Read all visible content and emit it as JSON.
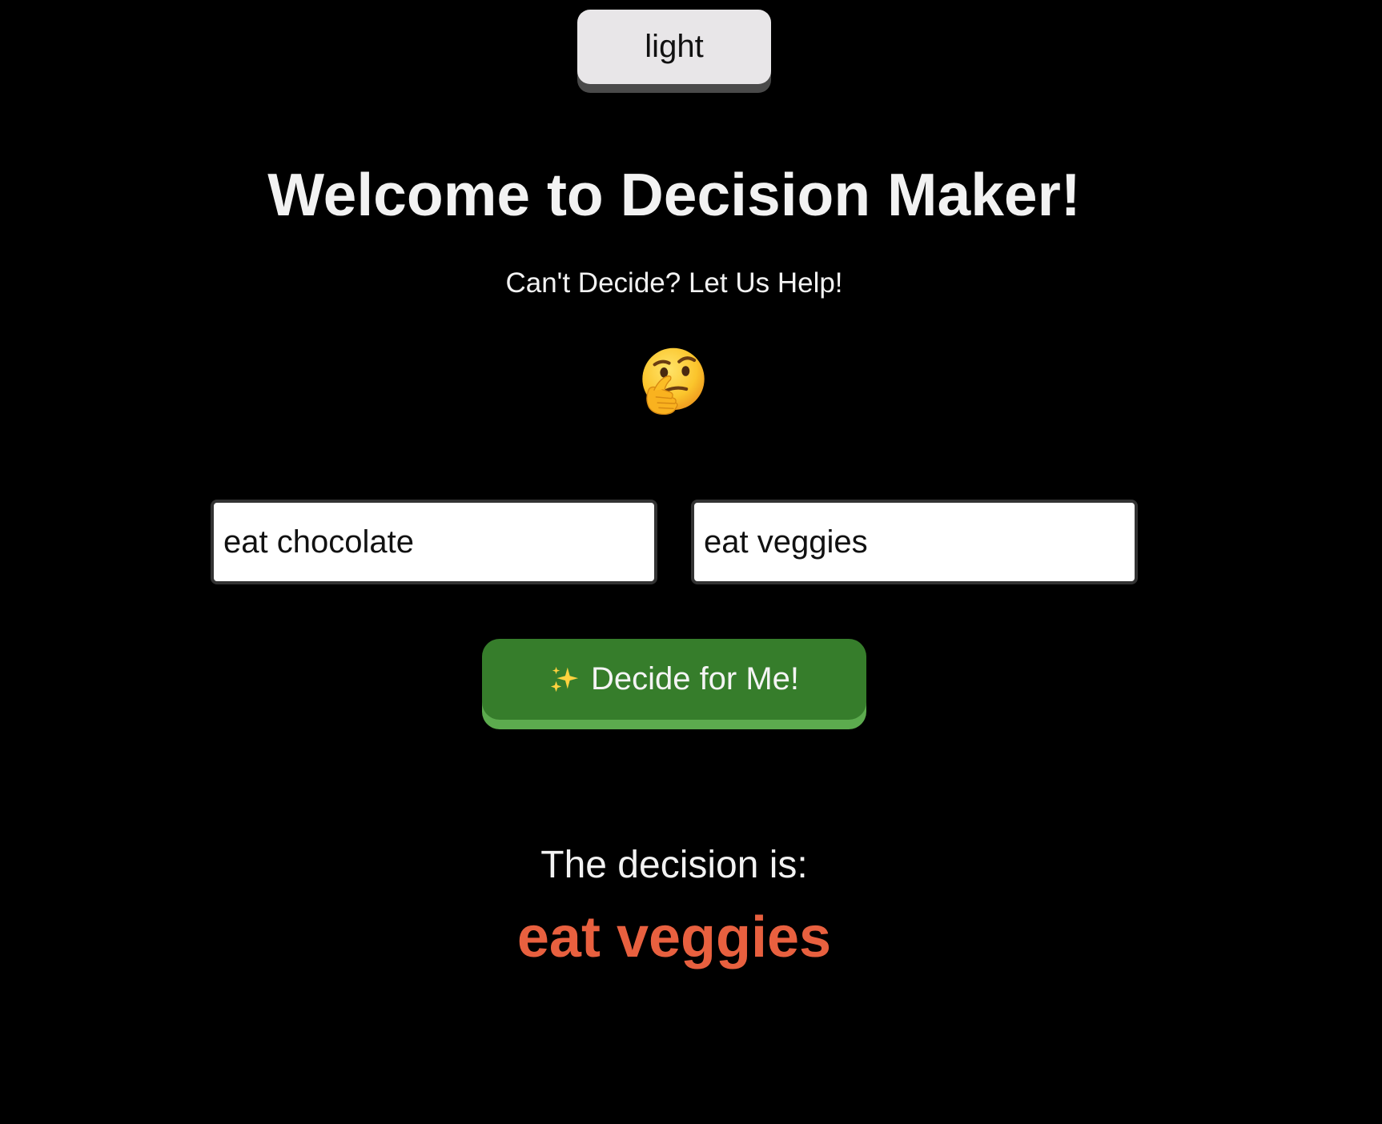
{
  "theme_toggle": {
    "label": "light"
  },
  "header": {
    "title": "Welcome to Decision Maker!",
    "subtitle": "Can't Decide? Let Us Help!",
    "emoji_icon": "thinking-face-icon"
  },
  "options": {
    "option_1_value": "eat chocolate",
    "option_2_value": "eat veggies"
  },
  "decide_button": {
    "icon": "sparkles-icon",
    "label": "Decide for Me!"
  },
  "result": {
    "label": "The decision is:",
    "value": "eat veggies"
  },
  "colors": {
    "background": "#000000",
    "text": "#f2f2f2",
    "toggle_background": "#e8e6e8",
    "button_green": "#367d2b",
    "button_green_shadow": "#5cab4e",
    "result_accent": "#e8603f"
  }
}
